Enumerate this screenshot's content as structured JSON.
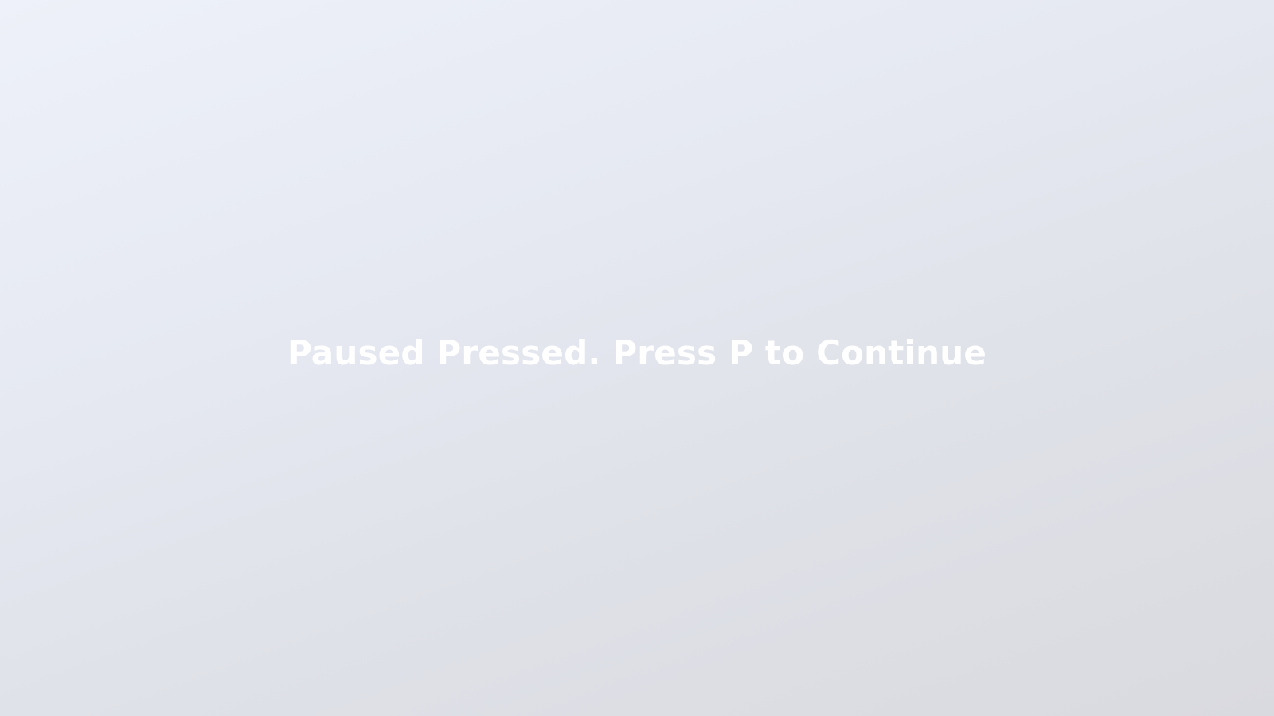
{
  "pause_overlay": {
    "message": "Paused Pressed. Press P to Continue"
  },
  "colors": {
    "background_start": "#eef1f9",
    "background_end": "#d9dadf",
    "message_text": "#ffffff"
  }
}
